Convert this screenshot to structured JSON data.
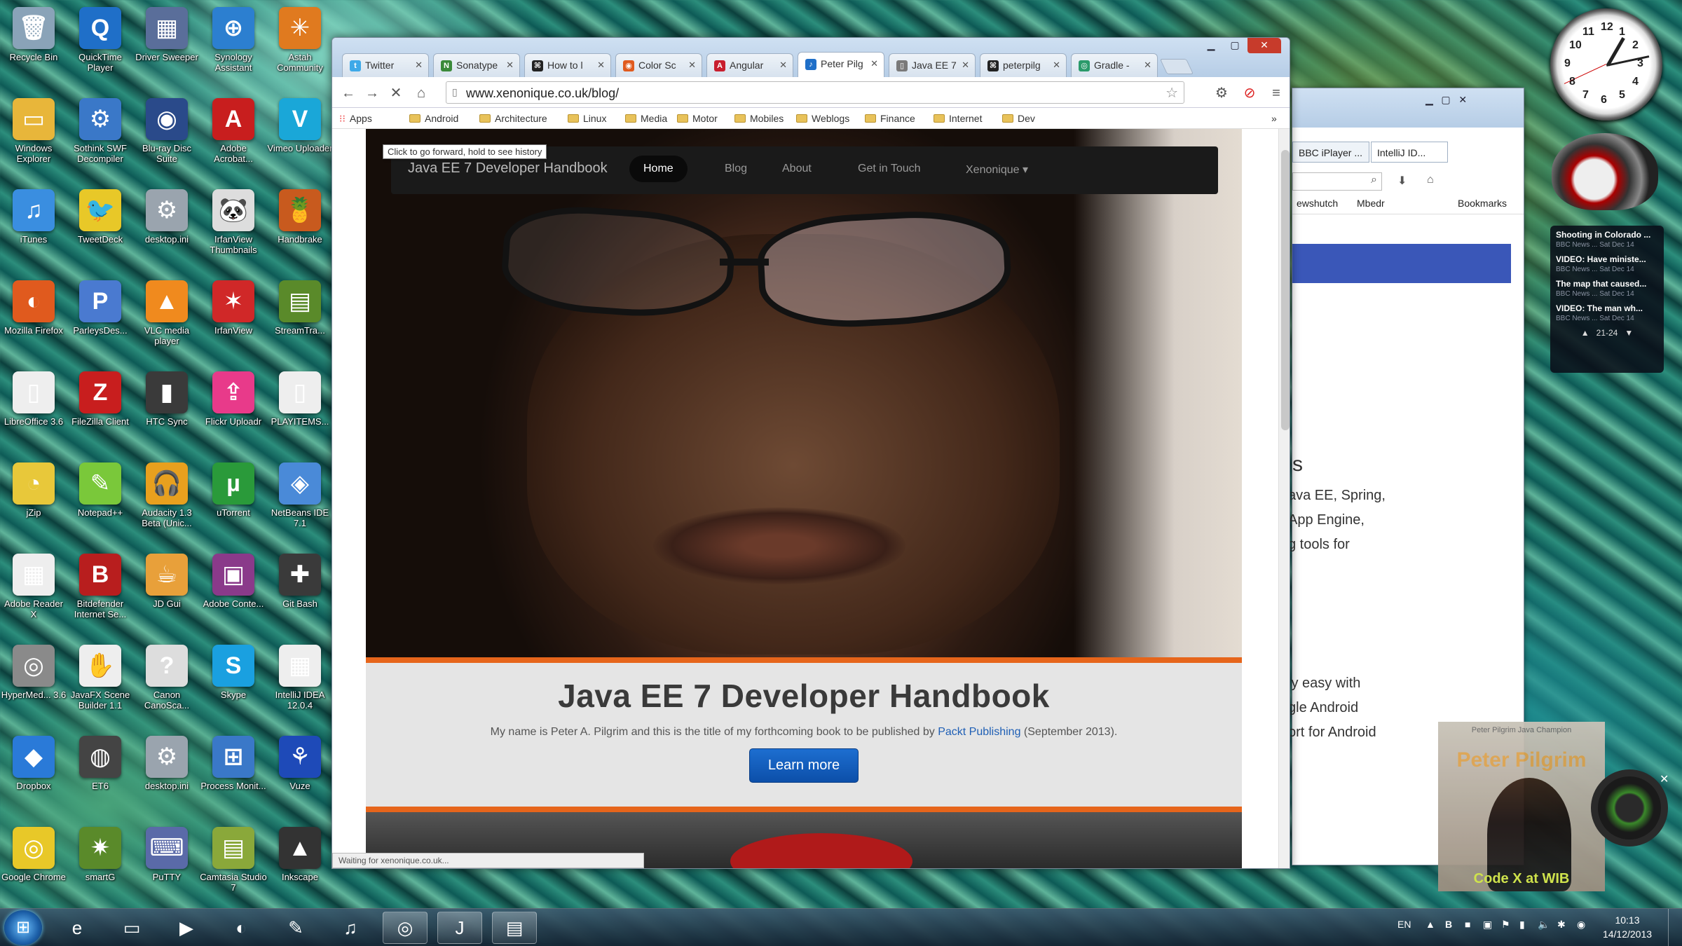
{
  "desktop_icons": [
    {
      "label": "Recycle Bin",
      "icon": "recycle-bin-icon",
      "color": "#8aa3b8",
      "glyph": "🗑"
    },
    {
      "label": "QuickTime Player",
      "icon": "quicktime-icon",
      "color": "#1f6fc8",
      "glyph": "Q"
    },
    {
      "label": "Driver Sweeper",
      "icon": "driver-sweeper-icon",
      "color": "#5a6e9a",
      "glyph": "▦"
    },
    {
      "label": "Synology Assistant",
      "icon": "synology-icon",
      "color": "#2c7fd0",
      "glyph": "⊕"
    },
    {
      "label": "Astah Community",
      "icon": "astah-icon",
      "color": "#e07a1f",
      "glyph": "✳"
    },
    {
      "label": "Windows Explorer",
      "icon": "folder-icon",
      "color": "#e8b63a",
      "glyph": "▭"
    },
    {
      "label": "Sothink SWF Decompiler",
      "icon": "sothink-icon",
      "color": "#3a78c8",
      "glyph": "⚙"
    },
    {
      "label": "Blu-ray Disc Suite",
      "icon": "bluray-icon",
      "color": "#2a4a8a",
      "glyph": "◉"
    },
    {
      "label": "Adobe Acrobat...",
      "icon": "acrobat-icon",
      "color": "#c81e1e",
      "glyph": "A"
    },
    {
      "label": "Vimeo Uploader",
      "icon": "vimeo-icon",
      "color": "#1aa7d8",
      "glyph": "V"
    },
    {
      "label": "iTunes",
      "icon": "itunes-icon",
      "color": "#3a8ee0",
      "glyph": "♫"
    },
    {
      "label": "TweetDeck",
      "icon": "tweetdeck-icon",
      "color": "#e8c828",
      "glyph": "🐦"
    },
    {
      "label": "desktop.ini",
      "icon": "ini-file-icon",
      "color": "#9aa4ae",
      "glyph": "⚙"
    },
    {
      "label": "IrfanView Thumbnails",
      "icon": "irfanview-thumbs-icon",
      "color": "#ddd",
      "glyph": "🐼"
    },
    {
      "label": "Handbrake",
      "icon": "handbrake-icon",
      "color": "#c85a1e",
      "glyph": "🍍"
    },
    {
      "label": "Mozilla Firefox",
      "icon": "firefox-icon",
      "color": "#e05a1e",
      "glyph": "◐"
    },
    {
      "label": "ParleysDes...",
      "icon": "parleys-icon",
      "color": "#4a7ad0",
      "glyph": "P"
    },
    {
      "label": "VLC media player",
      "icon": "vlc-icon",
      "color": "#f08a1e",
      "glyph": "▲"
    },
    {
      "label": "IrfanView",
      "icon": "irfanview-icon",
      "color": "#d02828",
      "glyph": "✶"
    },
    {
      "label": "StreamTra...",
      "icon": "streamtransport-icon",
      "color": "#5a8a2a",
      "glyph": "▤"
    },
    {
      "label": "LibreOffice 3.6",
      "icon": "libreoffice-icon",
      "color": "#eee",
      "glyph": "▯"
    },
    {
      "label": "FileZilla Client",
      "icon": "filezilla-icon",
      "color": "#c81e1e",
      "glyph": "Z"
    },
    {
      "label": "HTC Sync",
      "icon": "htc-sync-icon",
      "color": "#3a3a3a",
      "glyph": "▮"
    },
    {
      "label": "Flickr Uploadr",
      "icon": "flickr-icon",
      "color": "#e83a8a",
      "glyph": "⇪"
    },
    {
      "label": "PLAYITEMS...",
      "icon": "file-icon",
      "color": "#eee",
      "glyph": "▯"
    },
    {
      "label": "jZip",
      "icon": "jzip-icon",
      "color": "#e8c83a",
      "glyph": "◔"
    },
    {
      "label": "Notepad++",
      "icon": "notepadpp-icon",
      "color": "#7ac83a",
      "glyph": "✎"
    },
    {
      "label": "Audacity 1.3 Beta (Unic...",
      "icon": "audacity-icon",
      "color": "#e8a01e",
      "glyph": "🎧"
    },
    {
      "label": "uTorrent",
      "icon": "utorrent-icon",
      "color": "#2a9a3a",
      "glyph": "µ"
    },
    {
      "label": "NetBeans IDE 7.1",
      "icon": "netbeans-icon",
      "color": "#4a8ad8",
      "glyph": "◈"
    },
    {
      "label": "Adobe Reader X",
      "icon": "adobe-reader-icon",
      "color": "#eee",
      "glyph": "▦"
    },
    {
      "label": "Bitdefender Internet Se...",
      "icon": "bitdefender-icon",
      "color": "#b81e1e",
      "glyph": "B"
    },
    {
      "label": "JD Gui",
      "icon": "jdgui-icon",
      "color": "#e8a03a",
      "glyph": "☕"
    },
    {
      "label": "Adobe Conte...",
      "icon": "adobe-contribute-icon",
      "color": "#8a3a8a",
      "glyph": "▣"
    },
    {
      "label": "Git Bash",
      "icon": "git-bash-icon",
      "color": "#3a3a3a",
      "glyph": "✚"
    },
    {
      "label": "HyperMed... 3.6",
      "icon": "hypermedia-icon",
      "color": "#8a8a8a",
      "glyph": "◎"
    },
    {
      "label": "JavaFX Scene Builder 1.1",
      "icon": "scenebuilder-icon",
      "color": "#eee",
      "glyph": "✋"
    },
    {
      "label": "Canon CanoSca...",
      "icon": "canon-icon",
      "color": "#ddd",
      "glyph": "?"
    },
    {
      "label": "Skype",
      "icon": "skype-icon",
      "color": "#1aa0e0",
      "glyph": "S"
    },
    {
      "label": "IntelliJ IDEA 12.0.4",
      "icon": "intellij-icon",
      "color": "#eee",
      "glyph": "▦"
    },
    {
      "label": "Dropbox",
      "icon": "dropbox-icon",
      "color": "#2a7ad8",
      "glyph": "◆"
    },
    {
      "label": "ET6",
      "icon": "et6-icon",
      "color": "#444",
      "glyph": "◍"
    },
    {
      "label": "desktop.ini",
      "icon": "ini-file-icon",
      "color": "#9aa4ae",
      "glyph": "⚙"
    },
    {
      "label": "Process Monit...",
      "icon": "process-monitor-icon",
      "color": "#3a78c8",
      "glyph": "⊞"
    },
    {
      "label": "Vuze",
      "icon": "vuze-icon",
      "color": "#1e4ab8",
      "glyph": "⚘"
    },
    {
      "label": "Google Chrome",
      "icon": "chrome-icon",
      "color": "#e8c828",
      "glyph": "◎"
    },
    {
      "label": "smartG",
      "icon": "smartgit-icon",
      "color": "#5a8a2a",
      "glyph": "✷"
    },
    {
      "label": "PuTTY",
      "icon": "putty-icon",
      "color": "#5a6aa8",
      "glyph": "⌨"
    },
    {
      "label": "Camtasia Studio 7",
      "icon": "camtasia-icon",
      "color": "#8aa83a",
      "glyph": "▤"
    },
    {
      "label": "Inkscape",
      "icon": "inkscape-icon",
      "color": "#333",
      "glyph": "▲"
    }
  ],
  "browser": {
    "tabs": [
      {
        "label": "Twitter",
        "icon": "twitter-icon",
        "color": "#3ea9e8",
        "glyph": "t"
      },
      {
        "label": "Sonatype",
        "icon": "sonatype-icon",
        "color": "#3a8a3a",
        "glyph": "N"
      },
      {
        "label": "How to l",
        "icon": "github-icon",
        "color": "#222",
        "glyph": "⌘"
      },
      {
        "label": "Color Sc",
        "icon": "color-scheme-icon",
        "color": "#e05a1e",
        "glyph": "◉"
      },
      {
        "label": "Angular",
        "icon": "angular-icon",
        "color": "#c81e2e",
        "glyph": "A"
      },
      {
        "label": "Peter Pilg",
        "icon": "xenonique-icon",
        "color": "#1f6fc8",
        "glyph": "♪"
      },
      {
        "label": "Java EE 7",
        "icon": "page-icon",
        "color": "#7a7a7a",
        "glyph": "▯"
      },
      {
        "label": "peterpilg",
        "icon": "github-icon",
        "color": "#222",
        "glyph": "⌘"
      },
      {
        "label": "Gradle -",
        "icon": "gradle-icon",
        "color": "#2a9a6a",
        "glyph": "◎"
      }
    ],
    "active_tab": 5,
    "url": "www.xenonique.co.uk/blog/",
    "tooltip": "Click to go forward, hold to see history",
    "bookmarks": [
      "Apps",
      "Android",
      "Architecture",
      "Linux",
      "Media",
      "Motor",
      "Mobiles",
      "Weblogs",
      "Finance",
      "Internet",
      "Dev"
    ],
    "status": "Waiting for xenonique.co.uk...",
    "site": {
      "brand": "Java EE 7 Developer Handbook",
      "nav": [
        "Home",
        "Blog",
        "About",
        "Get in Touch",
        "Xenonique"
      ],
      "heading": "Java EE 7 Developer Handbook",
      "text_before": "My name is Peter A. Pilgrim and this is the title of my forthcoming book to be published by ",
      "link": "Packt Publishing",
      "text_after": " (September 2013).",
      "button": "Learn more"
    }
  },
  "background_window": {
    "tabs": [
      "BBC iPlayer ...",
      "IntelliJ ID..."
    ],
    "bookmarks": [
      "ewshutch",
      "Mbedr",
      "Bookmarks"
    ],
    "text_lines": [
      "s",
      "ava EE, Spring,",
      "App Engine,",
      "g tools for",
      "ly easy with",
      "gle Android",
      "ort for Android"
    ]
  },
  "news_gadget": {
    "items": [
      {
        "title": "Shooting in Colorado ...",
        "meta": "BBC News ... Sat Dec 14"
      },
      {
        "title": "VIDEO: Have ministe...",
        "meta": "BBC News ... Sat Dec 14"
      },
      {
        "title": "The map that caused...",
        "meta": "BBC News ... Sat Dec 14"
      },
      {
        "title": "VIDEO: The man wh...",
        "meta": "BBC News ... Sat Dec 14"
      }
    ],
    "pager": "21-24"
  },
  "clock_numbers": [
    "12",
    "1",
    "2",
    "3",
    "4",
    "5",
    "6",
    "7",
    "8",
    "9",
    "10",
    "11"
  ],
  "video_overlay": {
    "title": "Peter Pilgrim Java Champion",
    "name": "Peter Pilgrim",
    "caption": "Code X at WIB"
  },
  "taskbar": {
    "apps": [
      {
        "name": "ie",
        "icon": "internet-explorer-icon",
        "glyph": "e",
        "open": false
      },
      {
        "name": "explorer",
        "icon": "folder-icon",
        "glyph": "▭",
        "open": false
      },
      {
        "name": "media",
        "icon": "media-player-icon",
        "glyph": "▶",
        "open": false
      },
      {
        "name": "firefox",
        "icon": "firefox-icon",
        "glyph": "◐",
        "open": false
      },
      {
        "name": "paint",
        "icon": "paint-icon",
        "glyph": "✎",
        "open": false
      },
      {
        "name": "itunes",
        "icon": "itunes-icon",
        "glyph": "♫",
        "open": false
      },
      {
        "name": "chrome",
        "icon": "chrome-icon",
        "glyph": "◎",
        "open": true
      },
      {
        "name": "intellij",
        "icon": "intellij-icon",
        "glyph": "J",
        "open": true
      },
      {
        "name": "camtasia",
        "icon": "camtasia-icon",
        "glyph": "▤",
        "open": true
      }
    ],
    "language": "EN",
    "time": "10:13",
    "date": "14/12/2013"
  }
}
